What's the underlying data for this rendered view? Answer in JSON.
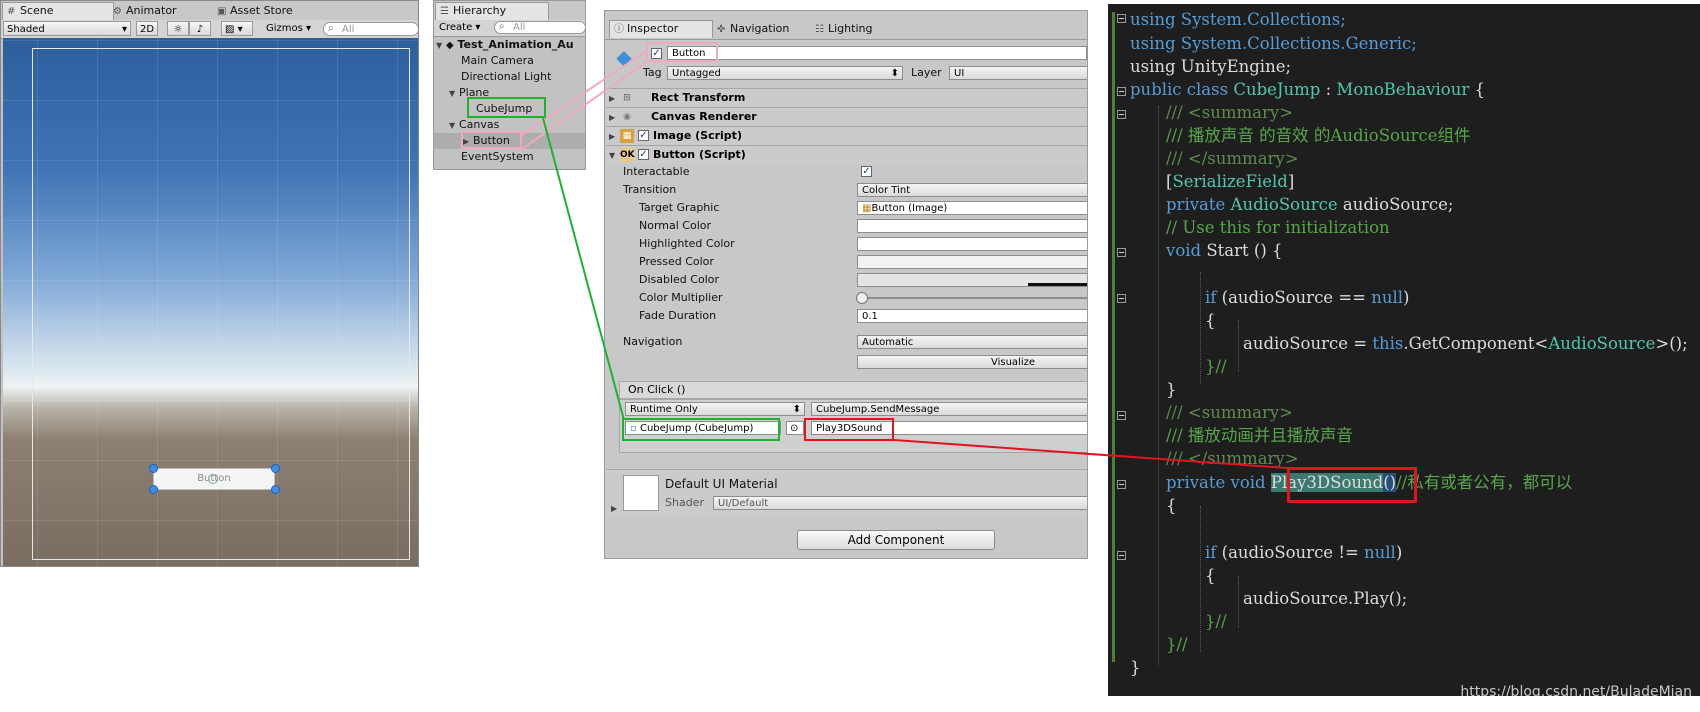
{
  "scene": {
    "tabs": [
      {
        "label": "Scene",
        "icon": "grid-icon"
      },
      {
        "label": "Animator",
        "icon": "animator-icon"
      },
      {
        "label": "Asset Store",
        "icon": "store-icon"
      }
    ],
    "shading_mode": "Shaded",
    "mode_2d": "2D",
    "gizmos": "Gizmos",
    "search_placeholder": "All",
    "ui_button_label": "Button"
  },
  "hierarchy": {
    "tab": "Hierarchy",
    "create": "Create",
    "search_placeholder": "All",
    "scene_name": "Test_Animation_Au",
    "items": [
      {
        "label": "Main Camera"
      },
      {
        "label": "Directional Light"
      },
      {
        "label": "Plane"
      },
      {
        "label": "CubeJump"
      },
      {
        "label": "Canvas"
      },
      {
        "label": "Button"
      },
      {
        "label": "EventSystem"
      }
    ]
  },
  "inspector": {
    "tabs": [
      "Inspector",
      "Navigation",
      "Lighting"
    ],
    "object_name": "Button",
    "tag_label": "Tag",
    "tag_value": "Untagged",
    "layer_label": "Layer",
    "layer_value": "UI",
    "components": [
      "Rect Transform",
      "Canvas Renderer",
      "Image (Script)",
      "Button (Script)"
    ],
    "props": {
      "interactable": "Interactable",
      "transition": "Transition",
      "transition_value": "Color Tint",
      "target_graphic": "Target Graphic",
      "target_graphic_value": "Button (Image)",
      "normal_color": "Normal Color",
      "highlighted_color": "Highlighted Color",
      "pressed_color": "Pressed Color",
      "disabled_color": "Disabled Color",
      "color_multiplier": "Color Multiplier",
      "fade_duration": "Fade Duration",
      "fade_duration_value": "0.1",
      "navigation": "Navigation",
      "navigation_value": "Automatic",
      "visualize": "Visualize"
    },
    "onclick": {
      "header": "On Click ()",
      "runtime": "Runtime Only",
      "function": "CubeJump.SendMessage",
      "target": "CubeJump (CubeJump)",
      "argument": "Play3DSound"
    },
    "material": {
      "name": "Default UI Material",
      "shader_label": "Shader",
      "shader_value": "UI/Default"
    },
    "add_component": "Add Component"
  },
  "code": {
    "lines": {
      "l1": "using System.Collections;",
      "l2": "using System.Collections.Generic;",
      "l3": "using UnityEngine;",
      "class_kw": "public class ",
      "class_name": "CubeJump",
      "class_sep": " : ",
      "class_base": "MonoBehaviour",
      "class_brace": " {",
      "sum_open": "/// <summary>",
      "doc1": "/// 播放声音 的音效 的AudioSource组件",
      "sum_close": "/// </summary>",
      "attr_open": "[",
      "attr_name": "SerializeField",
      "attr_close": "]",
      "field_kw": "private ",
      "field_type": "AudioSource",
      "field_name": " audioSource;",
      "init_comment": "// Use this for initialization",
      "start_kw": "void ",
      "start_name": "Start () {",
      "if1_kw": "if ",
      "if1_cond": "(audioSource == ",
      "null_kw": "null",
      "paren_close": ")",
      "brace_open": "{",
      "assign_a": "audioSource = ",
      "this_kw": "this",
      "assign_b": ".GetComponent<",
      "assign_type": "AudioSource",
      "assign_c": ">();",
      "close_comment": "}//",
      "brace_close": "}",
      "sum2_open": "/// <summary>",
      "doc2": "/// 播放动画并且播放声音",
      "sum2_close": "/// </summary>",
      "method_kw": "private void ",
      "method_name": "Play3DSound",
      "method_parens": "()",
      "method_comment": "//私有或者公有，都可以",
      "if2_kw": "if ",
      "if2_cond": "(audioSource != ",
      "play": "audioSource.Play();",
      "end_class": "}"
    },
    "watermark": "https://blog.csdn.net/BuladeMian"
  },
  "annotations": {
    "pink": "#f2a7c3",
    "green": "#1db32e",
    "red": "#e0141e"
  }
}
